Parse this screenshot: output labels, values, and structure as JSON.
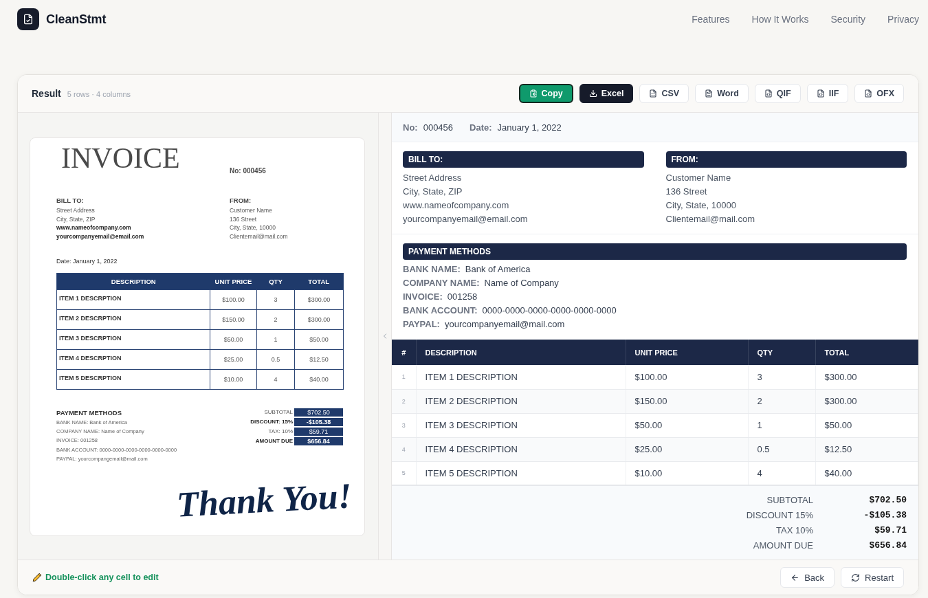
{
  "header": {
    "brand": "CleanStmt",
    "nav": [
      "Features",
      "How It Works",
      "Security",
      "Privacy"
    ]
  },
  "result": {
    "title": "Result",
    "summary": "5 rows · 4 columns",
    "actions": [
      {
        "label": "Copy",
        "kind": "copy"
      },
      {
        "label": "Excel",
        "kind": "download"
      },
      {
        "label": "CSV",
        "kind": "sheet"
      },
      {
        "label": "Word",
        "kind": "doc"
      },
      {
        "label": "QIF",
        "kind": "code"
      },
      {
        "label": "IIF",
        "kind": "code"
      },
      {
        "label": "OFX",
        "kind": "code"
      }
    ]
  },
  "source_document": {
    "title": "INVOICE",
    "number": "No: 000456",
    "parties": [
      {
        "heading": "BILL TO:",
        "lines": [
          {
            "text": "Street Address",
            "bold": false
          },
          {
            "text": "City, State, ZIP",
            "bold": false
          },
          {
            "text": "www.nameofcompany.com",
            "bold": true
          },
          {
            "text": "yourcompanyemail@email.com",
            "bold": true
          }
        ]
      },
      {
        "heading": "FROM:",
        "lines": [
          {
            "text": "Customer Name",
            "bold": false
          },
          {
            "text": "136 Street",
            "bold": false
          },
          {
            "text": "City, State, 10000",
            "bold": false
          },
          {
            "text": "Clientemail@mail.com",
            "bold": false
          }
        ]
      }
    ],
    "date": "Date: January 1, 2022",
    "table": {
      "columns": [
        "DESCRIPTION",
        "UNIT PRICE",
        "QTY",
        "TOTAL"
      ],
      "rows": [
        [
          "ITEM 1 DESCRPTION",
          "$100.00",
          "3",
          "$300.00"
        ],
        [
          "ITEM 2 DESCRPTION",
          "$150.00",
          "2",
          "$300.00"
        ],
        [
          "ITEM 3 DESCRPTION",
          "$50.00",
          "1",
          "$50.00"
        ],
        [
          "ITEM 4 DESCRPTION",
          "$25.00",
          "0.5",
          "$12.50"
        ],
        [
          "ITEM 5 DESCRPTION",
          "$10.00",
          "4",
          "$40.00"
        ]
      ]
    },
    "payment": {
      "heading": "PAYMENT METHODS",
      "lines": [
        "BANK NAME: Bank of America",
        "COMPANY NAME: Name of Company",
        "INVOICE: 001258",
        "BANK ACCOUNT: 0000-0000-0000-0000-0000-0000",
        "PAYPAL: yourcompangemail@mail.com"
      ]
    },
    "totals": [
      {
        "label": "SUBTOTAL",
        "value": "$702.50",
        "bold": false
      },
      {
        "label": "DISCOUNT: 15%",
        "value": "-$105.38",
        "bold": true
      },
      {
        "label": "TAX: 10%",
        "value": "$59.71",
        "bold": false
      },
      {
        "label": "AMOUNT DUE",
        "value": "$656.84",
        "bold": true
      }
    ],
    "closing": "Thank You!"
  },
  "extracted": {
    "meta": [
      {
        "label": "No:",
        "value": "000456"
      },
      {
        "label": "Date:",
        "value": "January 1, 2022"
      }
    ],
    "parties": [
      {
        "heading": "BILL TO:",
        "lines": [
          "Street Address",
          "City, State, ZIP",
          "www.nameofcompany.com",
          "yourcompanyemail@email.com"
        ]
      },
      {
        "heading": "FROM:",
        "lines": [
          "Customer Name",
          "136 Street",
          "City, State, 10000",
          "Clientemail@mail.com"
        ]
      }
    ],
    "payment": {
      "heading": "PAYMENT METHODS",
      "fields": [
        {
          "label": "BANK NAME:",
          "value": "Bank of America"
        },
        {
          "label": "COMPANY NAME:",
          "value": "Name of Company"
        },
        {
          "label": "INVOICE:",
          "value": "001258"
        },
        {
          "label": "BANK ACCOUNT:",
          "value": "0000-0000-0000-0000-0000-0000"
        },
        {
          "label": "PAYPAL:",
          "value": "yourcompanyemail@mail.com"
        }
      ]
    },
    "table": {
      "columns": [
        "#",
        "DESCRIPTION",
        "UNIT PRICE",
        "QTY",
        "TOTAL"
      ],
      "rows": [
        [
          "1",
          "ITEM 1 DESCRIPTION",
          "$100.00",
          "3",
          "$300.00"
        ],
        [
          "2",
          "ITEM 2 DESCRIPTION",
          "$150.00",
          "2",
          "$300.00"
        ],
        [
          "3",
          "ITEM 3 DESCRIPTION",
          "$50.00",
          "1",
          "$50.00"
        ],
        [
          "4",
          "ITEM 4 DESCRIPTION",
          "$25.00",
          "0.5",
          "$12.50"
        ],
        [
          "5",
          "ITEM 5 DESCRIPTION",
          "$10.00",
          "4",
          "$40.00"
        ]
      ]
    },
    "totals": [
      {
        "label": "SUBTOTAL",
        "value": "$702.50"
      },
      {
        "label": "DISCOUNT 15%",
        "value": "-$105.38"
      },
      {
        "label": "TAX 10%",
        "value": "$59.71"
      },
      {
        "label": "AMOUNT DUE",
        "value": "$656.84"
      }
    ]
  },
  "footer": {
    "hint": "Double-click any cell to edit",
    "buttons": [
      {
        "label": "Back",
        "kind": "back"
      },
      {
        "label": "Restart",
        "kind": "restart"
      }
    ]
  }
}
